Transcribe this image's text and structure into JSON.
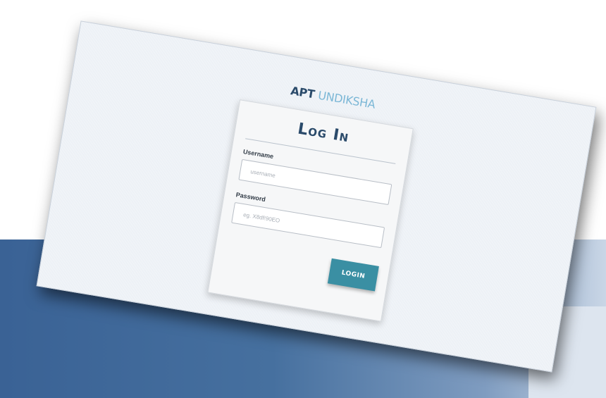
{
  "brand": {
    "strong": "APT",
    "light": "UNDIKSHA"
  },
  "login": {
    "title": "Log In",
    "username_label": "Username",
    "username_placeholder": "username",
    "password_label": "Password",
    "password_placeholder": "eg. X8df!90EO",
    "button_label": "LOGIN"
  },
  "colors": {
    "brand_dark": "#2a4a6a",
    "brand_light": "#7bb7d6",
    "button": "#3a8fa3",
    "backdrop_blue": "#3a6295"
  }
}
